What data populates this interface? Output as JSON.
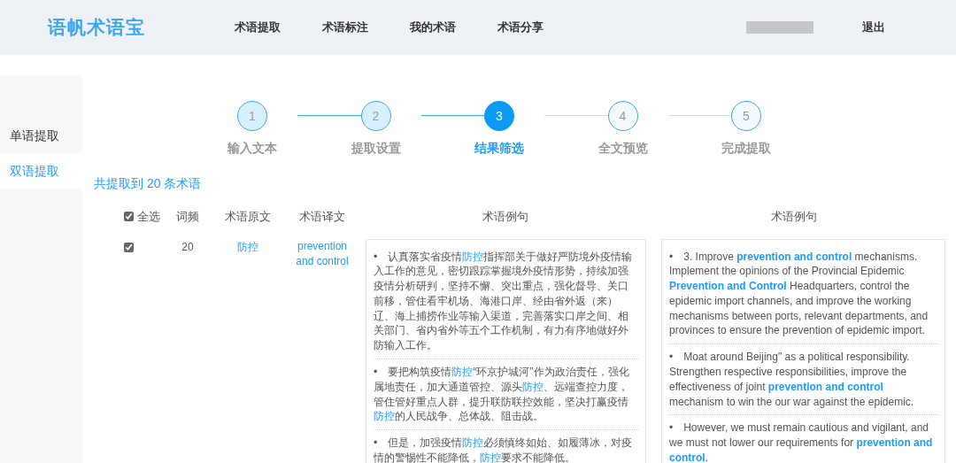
{
  "header": {
    "logo": "语帆术语宝",
    "nav": [
      {
        "label": "术语提取"
      },
      {
        "label": "术语标注"
      },
      {
        "label": "我的术语"
      },
      {
        "label": "术语分享"
      }
    ],
    "logout": "退出"
  },
  "sidebar": {
    "items": [
      {
        "label": "单语提取",
        "selected": false
      },
      {
        "label": "双语提取",
        "selected": true
      }
    ]
  },
  "steps": [
    {
      "number": "1",
      "label": "输入文本",
      "completed": true,
      "selected": false
    },
    {
      "number": "2",
      "label": "提取设置",
      "completed": true,
      "selected": false
    },
    {
      "number": "3",
      "label": "结果筛选",
      "completed": false,
      "selected": true
    },
    {
      "number": "4",
      "label": "全文预览",
      "completed": false,
      "selected": false
    },
    {
      "number": "5",
      "label": "完成提取",
      "completed": false,
      "selected": false
    }
  ],
  "summary": "共提取到 20 条术语",
  "table": {
    "columns": [
      {
        "label": "全选",
        "checked": true
      },
      {
        "label": "词频"
      },
      {
        "label": "术语原文"
      },
      {
        "label": "术语译文"
      },
      {
        "label": "术语例句"
      },
      {
        "label": "术语例句"
      }
    ],
    "rows": [
      {
        "checked": true,
        "frequency": "20",
        "source": "防控",
        "target": "prevention and control",
        "source_examples": [
          "•　认真落实省疫情**防控**指挥部关于做好严防境外疫情输入工作的意见，密切跟踪掌握境外疫情形势，持续加强疫情分析研判，坚持不懈、突出重点，强化督导、关口前移，管住看牢机场、海港口岸、经由省外返（来）辽、海上捕捞作业等输入渠道，完善落实口岸之间、相关部门、省内省外等五个工作机制，有力有序地做好外防输入工作。",
          "•　要把构筑疫情**防控**“环京护城河”作为政治责任，强化属地责任，加大通道管控、源头**防控**、远端查控力度，管住管好重点人群，提升联防联控效能，坚决打赢疫情**防控**的人民战争、总体战、阻击战。",
          "•　但是，加强疫情**防控**必须慎终如始、如履薄冰，对疫情的警惕性不能降低，**防控**要求不能降低。"
        ],
        "target_examples": [
          "•　3. Improve **prevention and control** mechanisms. Implement the opinions of the Provincial Epidemic **Prevention and Control** Headquarters, control the epidemic import channels, and improve the working mechanisms between ports, relevant departments, and provinces to ensure the prevention of epidemic import.",
          "•　Moat around Beijing\" as a political responsibility. Strengthen respective responsibilities, improve the effectiveness of joint **prevention and control** mechanism to win the our war against the epidemic.",
          "•　However, we must remain cautious and vigilant, and we must not lower our requirements for **prevention and control**."
        ]
      }
    ]
  }
}
